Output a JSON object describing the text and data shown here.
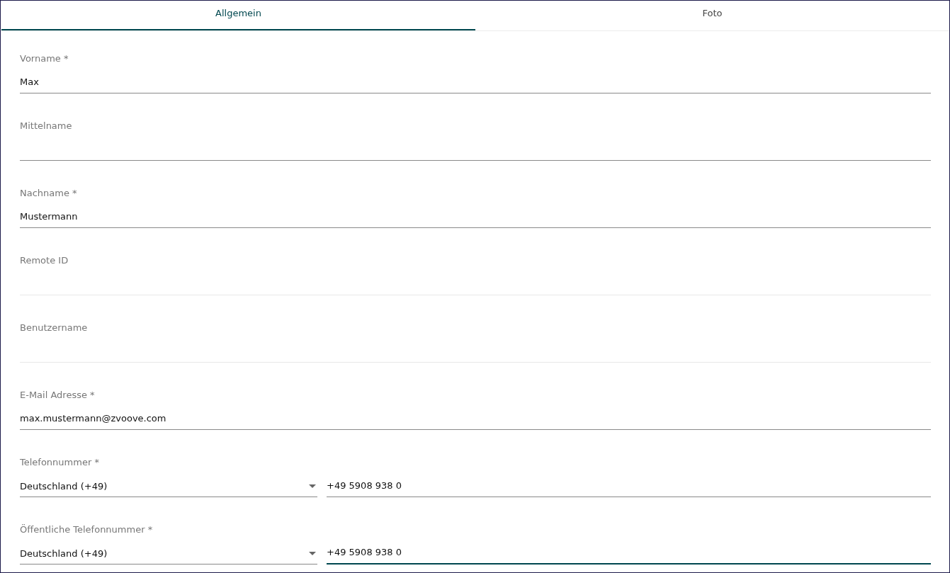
{
  "tabs": [
    {
      "label": "Allgemein",
      "selected": true
    },
    {
      "label": "Foto",
      "selected": false
    }
  ],
  "fields": [
    {
      "kind": "text",
      "label": "Vorname *",
      "value": "Max",
      "disabled": false,
      "focused": false
    },
    {
      "kind": "text",
      "label": "Mittelname",
      "disabled": false,
      "focused": false
    },
    {
      "kind": "text",
      "label": "Nachname *",
      "value": "Mustermann",
      "disabled": false,
      "focused": false
    },
    {
      "kind": "text",
      "label": "Remote ID",
      "disabled": true,
      "focused": false
    },
    {
      "kind": "text",
      "label": "Benutzername",
      "disabled": true,
      "focused": false
    },
    {
      "kind": "text",
      "label": "E-Mail Adresse *",
      "value": "max.mustermann@zvoove.com",
      "disabled": false,
      "focused": false
    },
    {
      "kind": "phone",
      "label": "Telefonnummer *",
      "country": "Deutschland (+49)",
      "value": "+49 5908 938 0",
      "disabled": false,
      "focused": false
    },
    {
      "kind": "phone",
      "label": "Öffentliche Telefonnummer *",
      "country": "Deutschland (+49)",
      "value": "+49 5908 938 0",
      "disabled": false,
      "focused": true
    }
  ]
}
